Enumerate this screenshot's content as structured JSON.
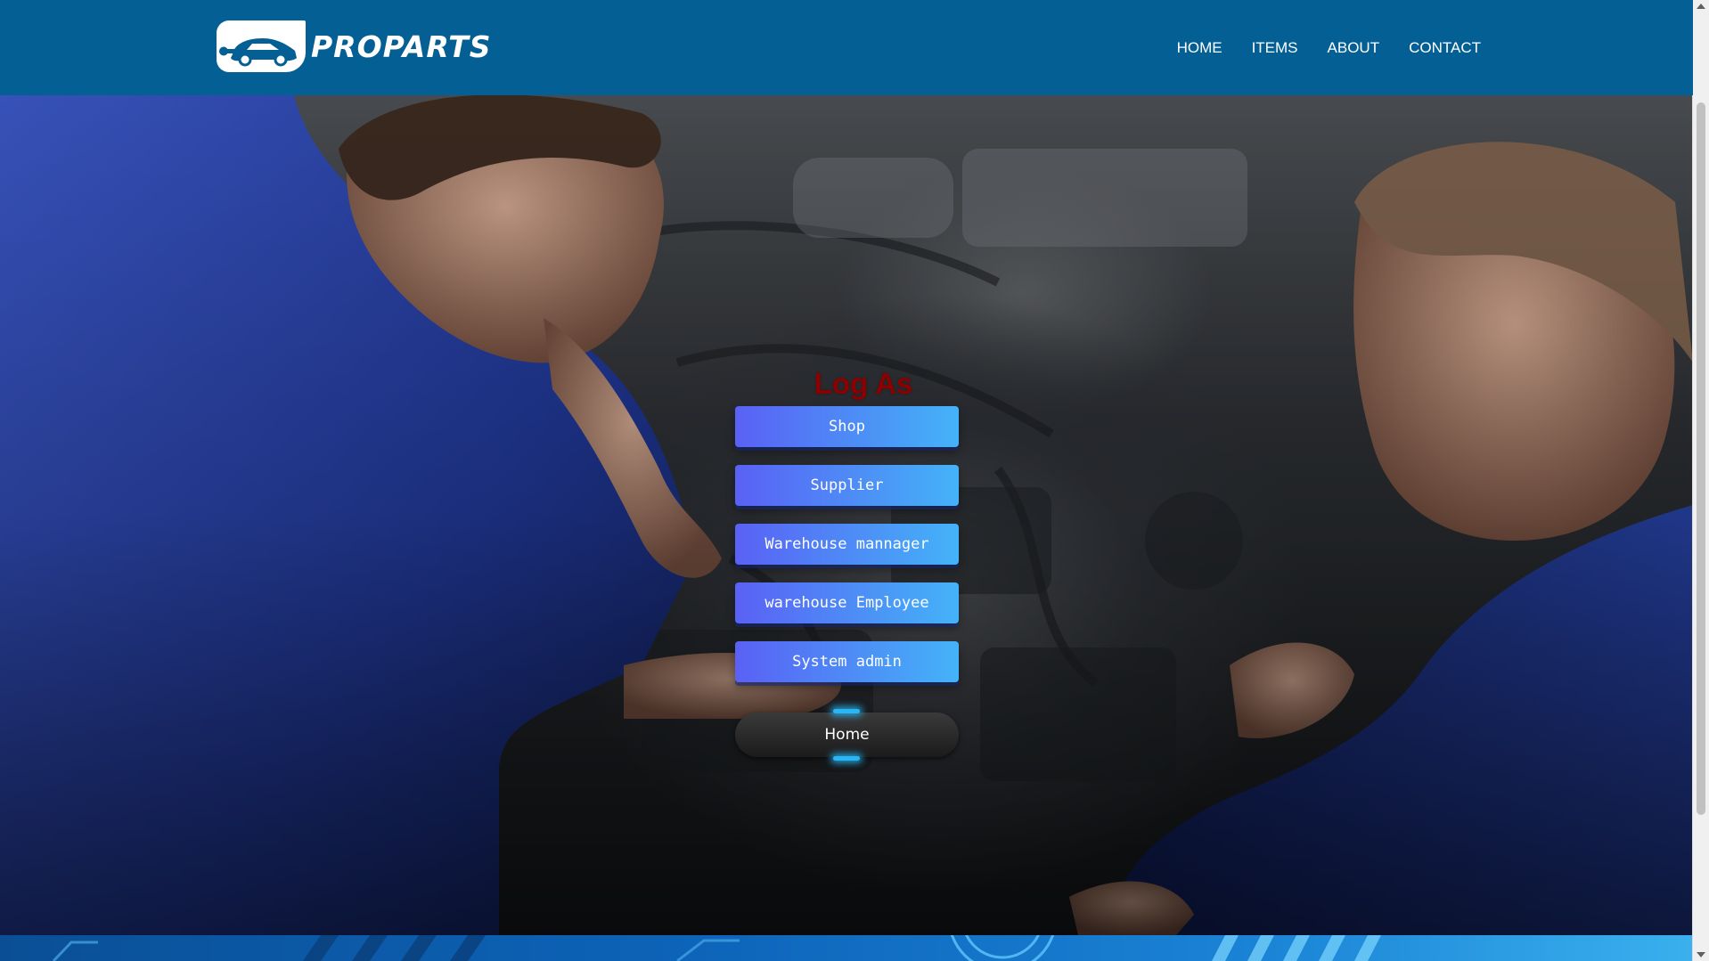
{
  "brand": {
    "name": "PROPARTS",
    "logo_icon": "car-wrench-icon"
  },
  "nav": {
    "items": [
      {
        "label": "HOME"
      },
      {
        "label": "ITEMS"
      },
      {
        "label": "ABOUT"
      },
      {
        "label": "CONTACT"
      }
    ]
  },
  "login": {
    "title": "Log As",
    "roles": [
      {
        "label": "Shop"
      },
      {
        "label": "Supplier"
      },
      {
        "label": "Warehouse mannager"
      },
      {
        "label": "warehouse Employee"
      },
      {
        "label": "System admin"
      }
    ],
    "home_label": "Home"
  },
  "colors": {
    "navbar": "#045f94",
    "title": "#8b0000",
    "button_gradient_start": "#5a61f5",
    "button_gradient_end": "#44b3f8",
    "home_glow": "#29b6f6"
  }
}
